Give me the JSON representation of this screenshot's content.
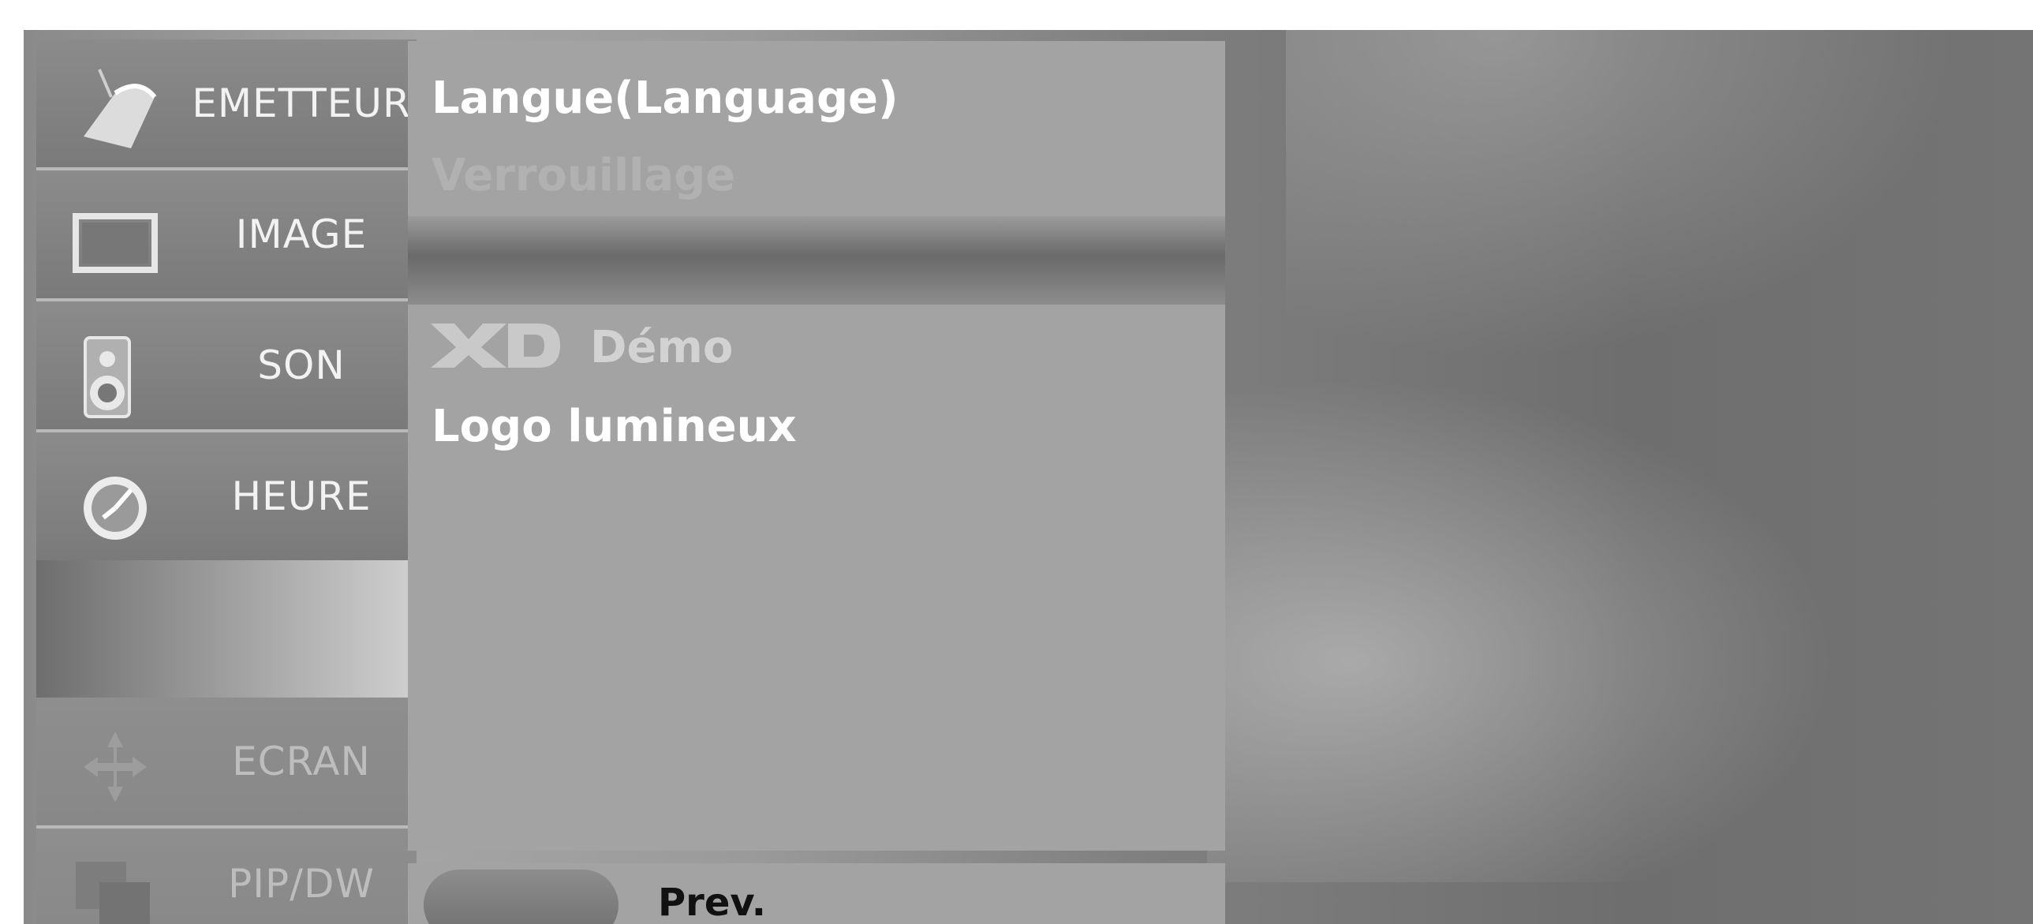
{
  "sidebar": {
    "items": [
      {
        "label": "EMETTEUR",
        "icon": "satellite-dish-icon"
      },
      {
        "label": "IMAGE",
        "icon": "screen-icon"
      },
      {
        "label": "SON",
        "icon": "speaker-icon"
      },
      {
        "label": "HEURE",
        "icon": "clock-icon"
      },
      {
        "label": "ECRAN",
        "icon": "arrows-icon"
      },
      {
        "label": "PIP/DW",
        "icon": "pip-icon"
      }
    ]
  },
  "menu": {
    "top_items": [
      "Langue(Language)",
      "Verrouillage"
    ],
    "xd_logo": "XD",
    "mid_items": [
      "Démo",
      "Logo lumineux"
    ]
  },
  "footer": {
    "prev_label": "Prev."
  },
  "colors": {
    "panel": "#a3a3a3",
    "tab": "#7f7f7f",
    "text_active": "#ffffff"
  }
}
